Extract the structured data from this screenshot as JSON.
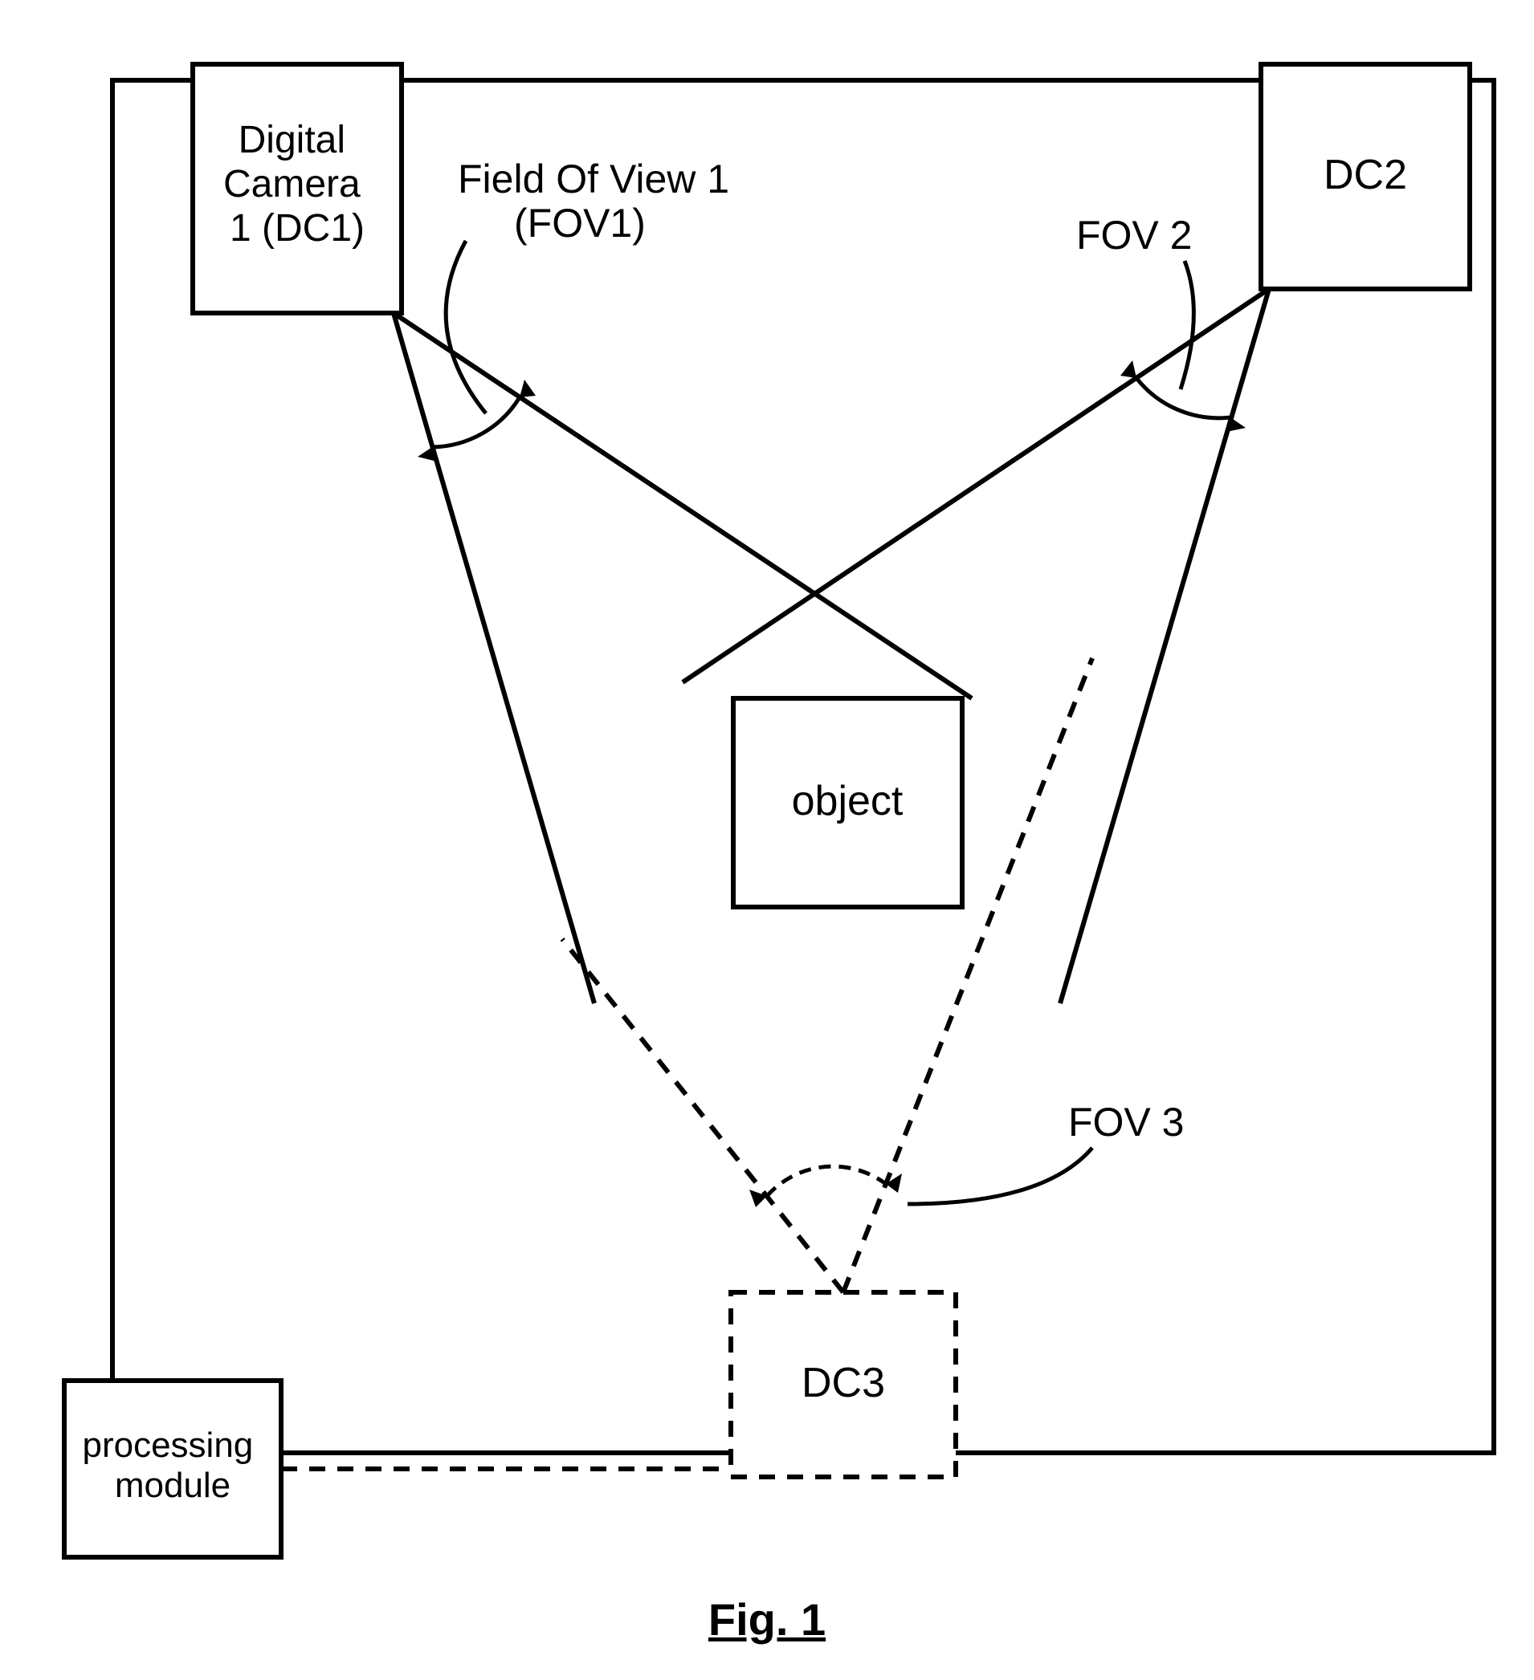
{
  "diagram": {
    "title": "Fig. 1",
    "blocks": {
      "dc1": "Digital Camera 1 (DC1)",
      "dc2": "DC2",
      "dc3": "DC3",
      "object": "object",
      "processing_module": "processing module"
    },
    "labels": {
      "fov1": "Field Of View 1 (FOV1)",
      "fov2": "FOV 2",
      "fov3": "FOV 3"
    }
  }
}
